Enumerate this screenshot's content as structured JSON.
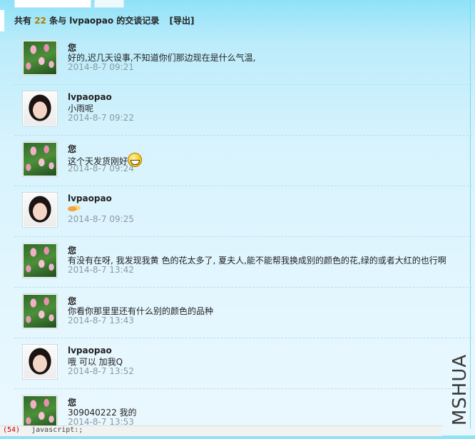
{
  "summary": {
    "prefix": "共有",
    "count": "22",
    "middle": "条与",
    "contact": "lvpaopao",
    "suffix": "的交谈记录",
    "export_label": "[导出]"
  },
  "messages": [
    {
      "name": "您",
      "text": "好的,迟几天设事,不知道你们那边现在是什么气温,",
      "time": "2014-8-7 09:21",
      "avatar": "tulip-avatar",
      "emoji": ""
    },
    {
      "name": "lvpaopao",
      "text": "小雨呢",
      "time": "2014-8-7 09:22",
      "avatar": "person-avatar",
      "emoji": ""
    },
    {
      "name": "您",
      "text": "这个天发货刚好",
      "time": "2014-8-7 09:24",
      "avatar": "tulip-avatar",
      "emoji": "grin-emoji"
    },
    {
      "name": "lvpaopao",
      "text": "",
      "time": "2014-8-7 09:25",
      "avatar": "person-avatar",
      "emoji": "handshake-emoji"
    },
    {
      "name": "您",
      "text": "有没有在呀, 我发现我黄  色的花太多了, 夏夫人,能不能帮我换成别的颜色的花,绿的或者大红的也行啊",
      "time": "2014-8-7 13:42",
      "avatar": "tulip-avatar",
      "emoji": ""
    },
    {
      "name": "您",
      "text": "你看你那里里还有什么别的颜色的品种",
      "time": "2014-8-7 13:43",
      "avatar": "tulip-avatar",
      "emoji": ""
    },
    {
      "name": "lvpaopao",
      "text": "哦 可以 加我Q",
      "time": "2014-8-7 13:52",
      "avatar": "person-avatar",
      "emoji": ""
    },
    {
      "name": "您",
      "text": "309040222 我的",
      "time": "2014-8-7 13:53",
      "avatar": "tulip-avatar",
      "emoji": ""
    }
  ],
  "watermark": "MSHUA",
  "bottom_line": {
    "number": "(54)",
    "code": "javascript:;"
  }
}
